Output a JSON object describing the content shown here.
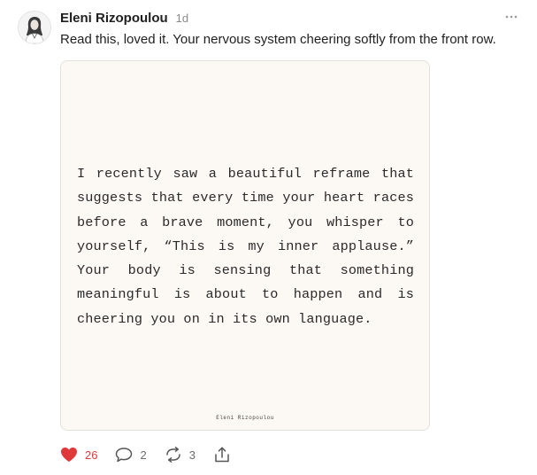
{
  "post": {
    "author": "Eleni Rizopoulou",
    "time": "1d",
    "caption": "Read this, loved it. Your nervous system cheering softly from the front row.",
    "card": {
      "quote": "I recently saw a beautiful reframe that suggests that every time your heart races before a brave moment, you whisper to yourself, “This is my inner applause.” Your body is sensing that something meaningful is about to happen and is cheering you on in its own language.",
      "signature": "Eleni Rizopoulou"
    },
    "actions": {
      "likes": "26",
      "comments": "2",
      "reposts": "3"
    },
    "colors": {
      "like": "#e0393b",
      "card_background": "#fcf9f4"
    },
    "icons": [
      "more-options-icon",
      "heart-icon",
      "comment-icon",
      "repost-icon",
      "share-icon"
    ]
  }
}
